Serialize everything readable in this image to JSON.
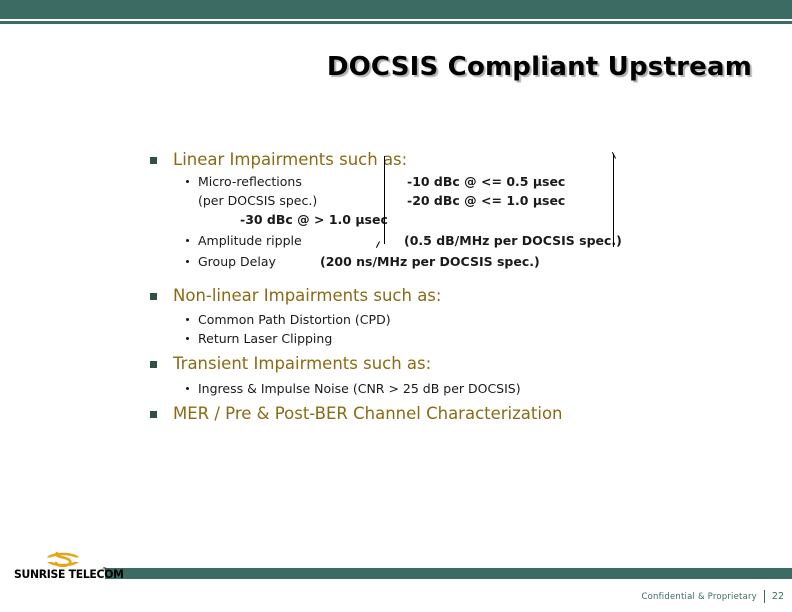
{
  "slide": {
    "title": "DOCSIS Compliant Upstream",
    "page_number": "22"
  },
  "theme": {
    "bar_color": "#3c6b63",
    "bullet_square_color": "#2f4f48",
    "level1_text_color": "#8a6a14",
    "body_text_color": "#1a1a1a",
    "footer_text_color": "#3c6b63",
    "logo_swoosh_color": "#e8a317"
  },
  "content": {
    "bullet1": {
      "label": "Linear Impairments such as:",
      "sub": [
        {
          "label": "Micro-reflections"
        },
        {
          "label": "Amplitude ripple"
        },
        {
          "label": "Group Delay"
        }
      ],
      "note_per_spec": "(per DOCSIS spec.)",
      "specs": {
        "spec_10": "-10 dBc @ <= 0.5 µsec",
        "spec_20": "-20 dBc @ <= 1.0 µsec",
        "spec_30": "-30 dBc @ > 1.0 µsec",
        "ripple_spec": "(0.5 dB/MHz per DOCSIS spec.)",
        "delay_spec": "(200 ns/MHz per DOCSIS spec.)"
      }
    },
    "bullet2": {
      "label": "Non-linear Impairments such as:",
      "sub": [
        {
          "label": "Common Path Distortion (CPD)"
        },
        {
          "label": "Return Laser Clipping"
        }
      ]
    },
    "bullet3": {
      "label": "Transient Impairments such as:",
      "sub": [
        {
          "label": "Ingress & Impulse Noise (CNR > 25 dB per DOCSIS)"
        }
      ]
    },
    "bullet4": {
      "label": "MER / Pre & Post-BER Channel Characterization"
    }
  },
  "footer": {
    "logo_text": "SUNRISE TELECOM",
    "logo_tm": "®",
    "confidential": "Confidential & Proprietary",
    "page_number": "22"
  }
}
